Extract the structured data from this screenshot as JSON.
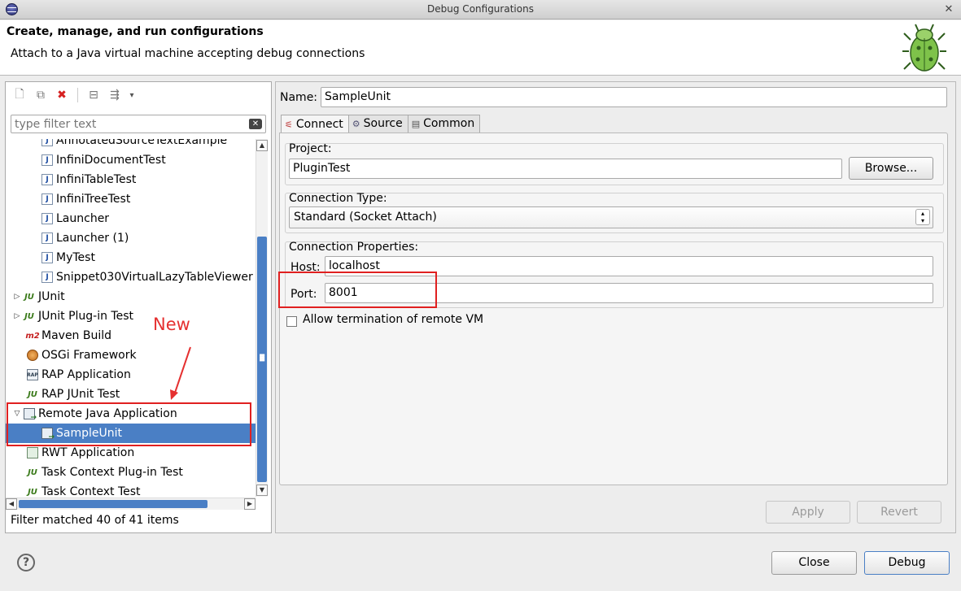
{
  "window": {
    "title": "Debug Configurations"
  },
  "header": {
    "title": "Create, manage, and run configurations",
    "subtitle": "Attach to a Java virtual machine accepting debug connections"
  },
  "left": {
    "toolbar": [
      "new-config-icon",
      "duplicate-icon",
      "delete-icon",
      "collapse-all-icon",
      "filter-icon",
      "view-menu-icon"
    ],
    "filter_placeholder": "type filter text",
    "tree": [
      {
        "label": "AnnotatedSourceTextExample",
        "level": 2,
        "icon": "junit-test-icon"
      },
      {
        "label": "InfiniDocumentTest",
        "level": 2,
        "icon": "junit-test-icon"
      },
      {
        "label": "InfiniTableTest",
        "level": 2,
        "icon": "junit-test-icon"
      },
      {
        "label": "InfiniTreeTest",
        "level": 2,
        "icon": "junit-test-icon"
      },
      {
        "label": "Launcher",
        "level": 2,
        "icon": "junit-test-icon"
      },
      {
        "label": "Launcher (1)",
        "level": 2,
        "icon": "junit-test-icon"
      },
      {
        "label": "MyTest",
        "level": 2,
        "icon": "junit-test-icon"
      },
      {
        "label": "Snippet030VirtualLazyTableViewer",
        "level": 2,
        "icon": "junit-test-icon"
      },
      {
        "label": "JUnit",
        "level": 1,
        "icon": "junit-icon",
        "twisty": "▷"
      },
      {
        "label": "JUnit Plug-in Test",
        "level": 1,
        "icon": "junit-plugin-icon",
        "twisty": "▷"
      },
      {
        "label": "Maven Build",
        "level": 1,
        "icon": "maven-icon"
      },
      {
        "label": "OSGi Framework",
        "level": 1,
        "icon": "osgi-icon"
      },
      {
        "label": "RAP Application",
        "level": 1,
        "icon": "rap-icon"
      },
      {
        "label": "RAP JUnit Test",
        "level": 1,
        "icon": "rap-junit-icon"
      },
      {
        "label": "Remote Java Application",
        "level": 1,
        "icon": "remote-java-icon",
        "twisty": "▽"
      },
      {
        "label": "SampleUnit",
        "level": 2,
        "icon": "remote-java-icon",
        "selected": true
      },
      {
        "label": "RWT Application",
        "level": 1,
        "icon": "rwt-icon"
      },
      {
        "label": "Task Context Plug-in Test",
        "level": 1,
        "icon": "task-plugin-icon"
      },
      {
        "label": "Task Context Test",
        "level": 1,
        "icon": "task-test-icon"
      }
    ],
    "status": "Filter matched 40 of 41 items"
  },
  "annotation": {
    "text": "New",
    "color": "#e53030"
  },
  "right": {
    "name_label": "Name:",
    "name_value": "SampleUnit",
    "tabs": [
      {
        "label": "Connect",
        "icon": "connect-icon",
        "active": true
      },
      {
        "label": "Source",
        "icon": "source-icon"
      },
      {
        "label": "Common",
        "icon": "common-icon"
      }
    ],
    "project_label": "Project:",
    "project_value": "PluginTest",
    "browse_label": "Browse...",
    "connection_type_label": "Connection Type:",
    "connection_type_value": "Standard (Socket Attach)",
    "connection_props_label": "Connection Properties:",
    "host_label": "Host:",
    "host_value": "localhost",
    "port_label": "Port:",
    "port_value": "8001",
    "allow_termination_label": "Allow termination of remote VM",
    "allow_termination_checked": false,
    "apply_label": "Apply",
    "revert_label": "Revert"
  },
  "footer": {
    "close_label": "Close",
    "debug_label": "Debug"
  },
  "colors": {
    "selection": "#4a7fc5",
    "highlight_box": "#e02020"
  }
}
